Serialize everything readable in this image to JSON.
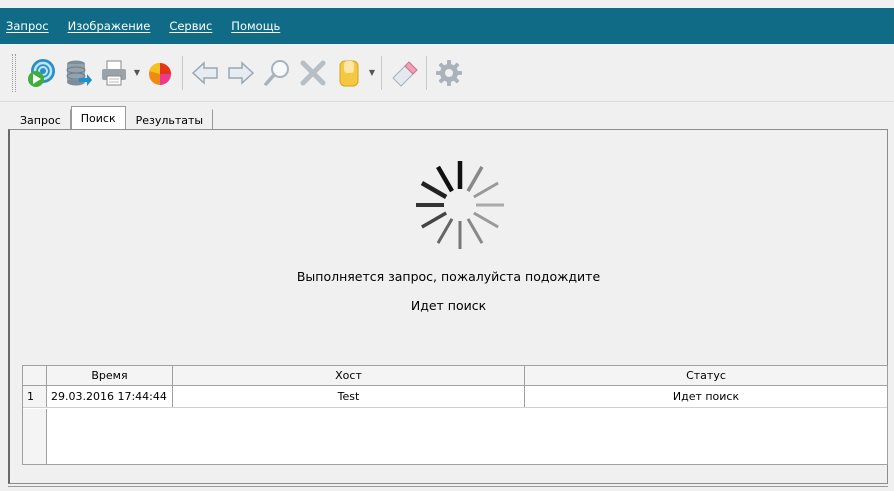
{
  "menu": {
    "items": [
      {
        "label": "Запрос"
      },
      {
        "label": "Изображение"
      },
      {
        "label": "Сервис"
      },
      {
        "label": "Помощь"
      }
    ]
  },
  "toolbar": {
    "buttons": [
      "run-query-icon",
      "database-icon",
      "print-icon",
      "pie-chart-icon",
      "back-arrow-icon",
      "forward-arrow-icon",
      "search-icon",
      "close-icon",
      "clipboard-icon",
      "eraser-icon",
      "gear-icon"
    ]
  },
  "tabs": [
    {
      "label": "Запрос"
    },
    {
      "label": "Поиск"
    },
    {
      "label": "Результаты"
    }
  ],
  "status": {
    "message": "Выполняется запрос, пожалуйста подождите",
    "state": "Идет поиск"
  },
  "grid": {
    "columns": [
      "Время",
      "Хост",
      "Статус"
    ],
    "rows": [
      {
        "num": "1",
        "time": "29.03.2016 17:44:44",
        "host": "Test",
        "status": "Идет поиск"
      }
    ]
  },
  "colors": {
    "menubar": "#0f6b86",
    "spinner": "#222222"
  }
}
